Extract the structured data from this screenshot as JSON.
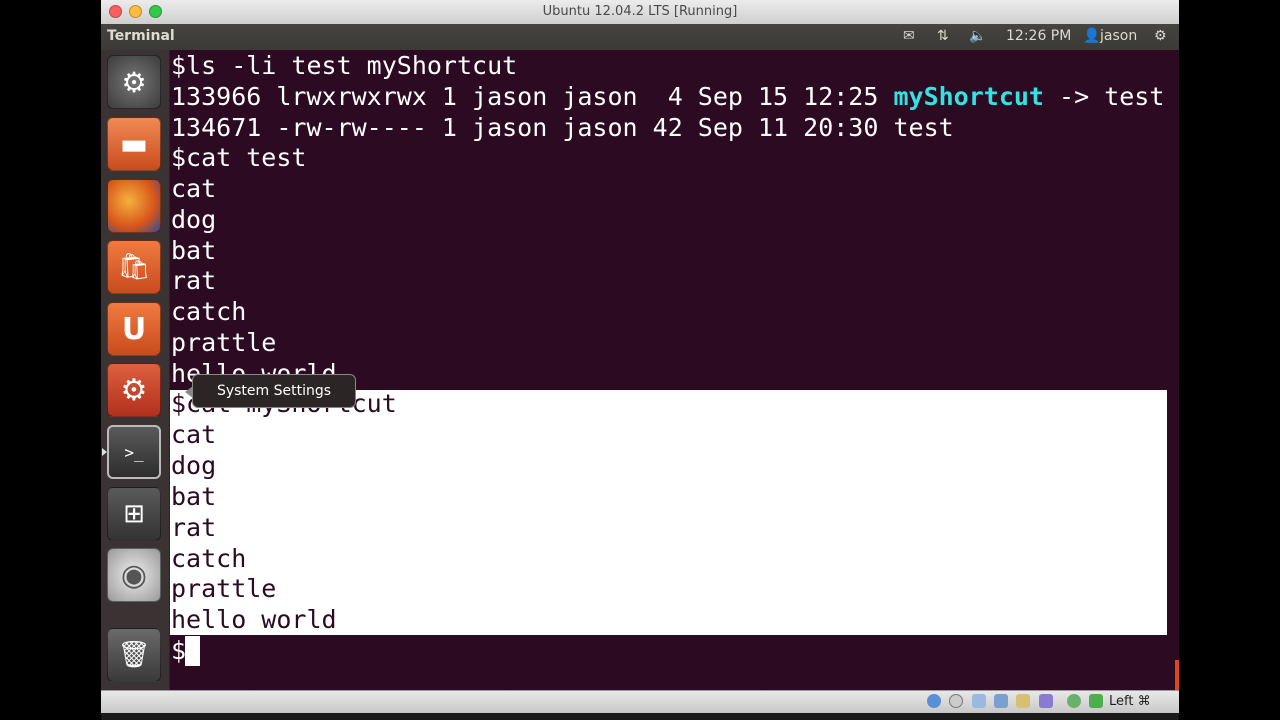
{
  "window": {
    "title": "Ubuntu 12.04.2 LTS [Running]"
  },
  "panel": {
    "title": "Terminal",
    "time": "12:26 PM",
    "user": "jason",
    "icons": [
      "mail-icon",
      "network-icon",
      "volume-icon",
      "user-icon",
      "gear-icon"
    ]
  },
  "launcher": {
    "items": [
      "dash-icon",
      "files-icon",
      "firefox-icon",
      "software-center-icon",
      "ubuntu-one-icon",
      "system-settings-icon",
      "terminal-icon",
      "workspace-switcher-icon",
      "dvd-icon",
      "trash-icon"
    ],
    "tooltip": "System Settings"
  },
  "terminal": {
    "lines": [
      "$ls -li test myShortcut",
      "133966 lrwxrwxrwx 1 jason jason  4 Sep 15 12:25 ",
      "134671 -rw-rw---- 1 jason jason 42 Sep 11 20:30 test",
      "$cat test",
      "cat",
      "dog",
      "bat",
      "rat",
      "catch",
      "prattle",
      "hello world",
      "$cat myShortcut",
      "cat",
      "dog",
      "bat",
      "rat",
      "catch",
      "prattle",
      "hello world",
      "$"
    ],
    "link_name": "myShortcut",
    "link_target": " -> test"
  },
  "statusbar": {
    "host_key": "Left ⌘"
  },
  "colors": {
    "terminal_bg": "#2c0a22",
    "link": "#34e2e2",
    "selection": "#ffffff",
    "panel": "#3c3b37"
  }
}
